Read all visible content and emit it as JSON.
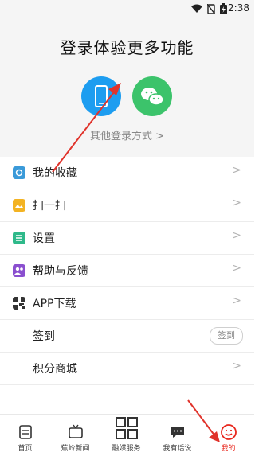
{
  "status_bar": {
    "time": "2:38",
    "icons": [
      "wifi-icon",
      "no-sim-icon",
      "battery-charging-icon"
    ]
  },
  "header": {
    "title": "登录体验更多功能",
    "login_options": [
      "phone-login-icon",
      "wechat-login-icon"
    ],
    "other_login": "其他登录方式 >"
  },
  "menu": [
    {
      "label": "我的收藏",
      "icon": "favorites-icon",
      "color": "#3a9ad9"
    },
    {
      "label": "扫一扫",
      "icon": "scan-icon",
      "color": "#f3b323"
    },
    {
      "label": "设置",
      "icon": "settings-icon",
      "color": "#2fb98a"
    },
    {
      "label": "帮助与反馈",
      "icon": "help-feedback-icon",
      "color": "#8a4fcf"
    },
    {
      "label": "APP下载",
      "icon": "qr-code-icon",
      "color": "#333333"
    },
    {
      "label": "签到",
      "button": "签到"
    },
    {
      "label": "积分商城"
    }
  ],
  "tabs": [
    {
      "label": "首页",
      "icon": "home-icon"
    },
    {
      "label": "蕉岭新闻",
      "icon": "tv-icon"
    },
    {
      "label": "融媒服务",
      "icon": "grid-icon"
    },
    {
      "label": "我有话说",
      "icon": "chat-icon"
    },
    {
      "label": "我的",
      "icon": "smile-icon",
      "active": true,
      "active_color": "#e8271d"
    }
  ],
  "annotation_color": "#e0332b"
}
